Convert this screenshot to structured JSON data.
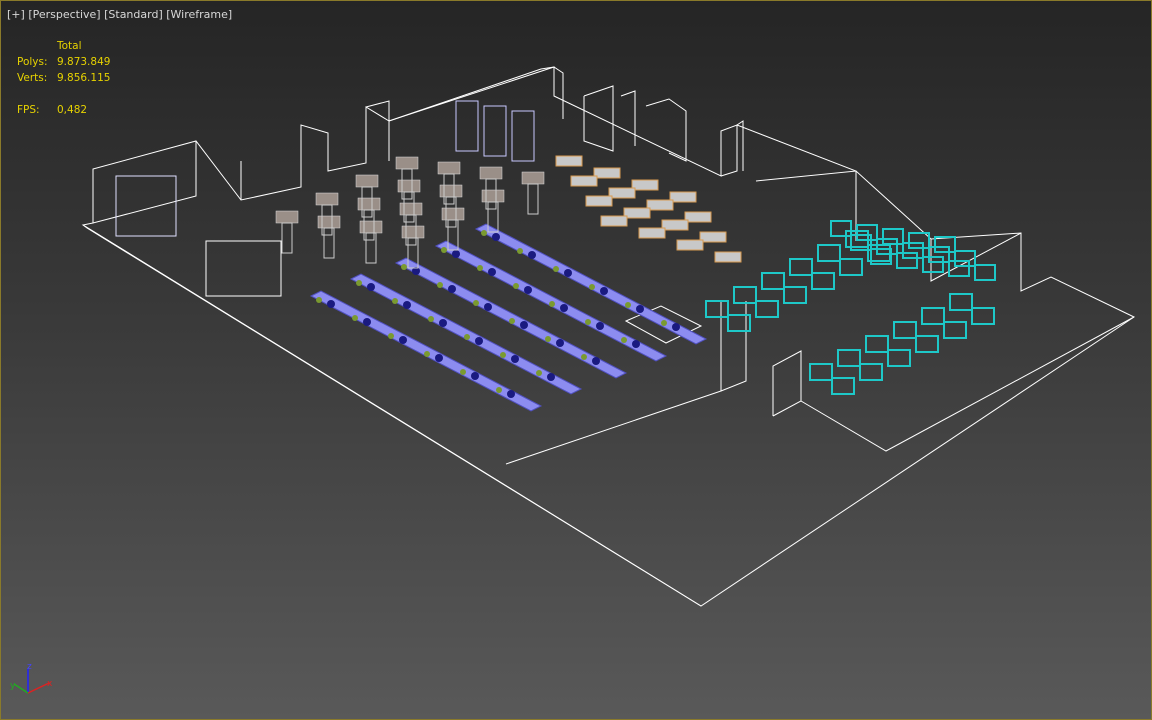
{
  "viewport": {
    "menu_plus": "[+]",
    "view_name": "[Perspective]",
    "shading_mode": "[Standard]",
    "display_mode": "[Wireframe]"
  },
  "stats": {
    "header": "Total",
    "polys_label": "Polys:",
    "polys_value": "9.873.849",
    "verts_label": "Verts:",
    "verts_value": "9.856.115",
    "fps_label": "FPS:",
    "fps_value": "0,482"
  },
  "axis": {
    "x": "x",
    "y": "y",
    "z": "z"
  },
  "colors": {
    "stats": "#e6d200",
    "wire": "#ffffff",
    "benches": "#8c8cf0",
    "desks": "#1ec8c8",
    "machines": "#9a8f88",
    "border": "#8a7a2a"
  }
}
